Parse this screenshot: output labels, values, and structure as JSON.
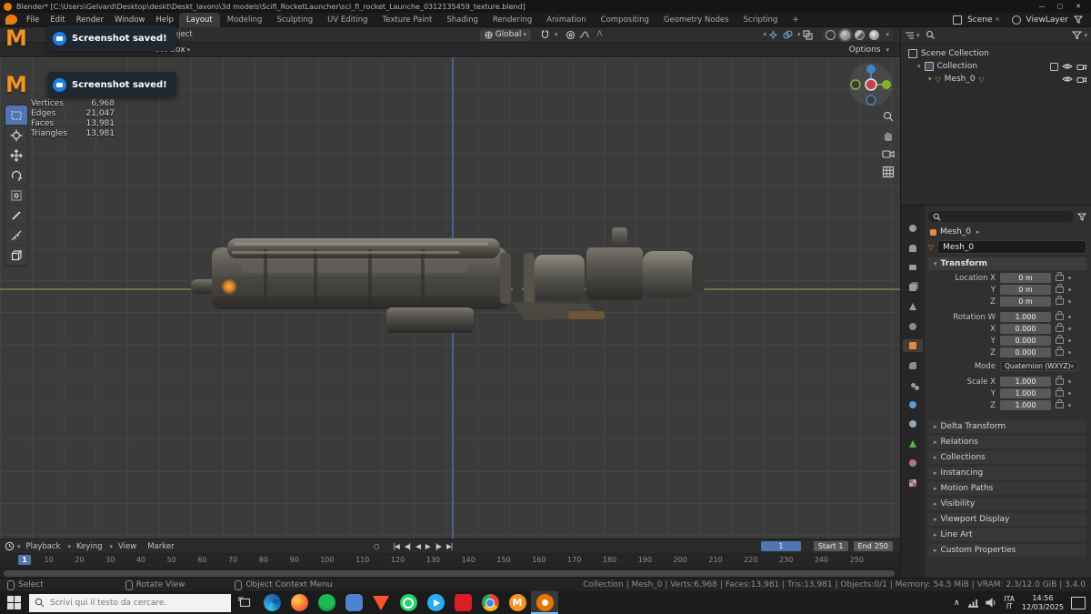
{
  "titlebar": {
    "title": "Blender* [C:\\Users\\Gelvard\\Desktop\\deskt\\Deskt_lavoro\\3d models\\Scifi_RocketLauncher\\sci_fi_rocket_Launche_0312135459_texture.blend]"
  },
  "icons": {
    "chevron": "▾",
    "minimize": "—",
    "maximize": "▢",
    "close": "✕",
    "plus": "+",
    "record": "○"
  },
  "topbar": {
    "menus": [
      "File",
      "Edit",
      "Render",
      "Window",
      "Help"
    ],
    "tabs": [
      "Layout",
      "Modeling",
      "Sculpting",
      "UV Editing",
      "Texture Paint",
      "Shading",
      "Rendering",
      "Animation",
      "Compositing",
      "Geometry Nodes",
      "Scripting"
    ],
    "scene_label": "Scene",
    "viewlayer_label": "ViewLayer"
  },
  "viewport_header": {
    "object_menu": "Object",
    "orientation": "Global",
    "tool_name": "ect Box",
    "options_label": "Options"
  },
  "toasts": [
    {
      "text": "Screenshot saved!"
    },
    {
      "text": "Screenshot saved!"
    }
  ],
  "stats": {
    "rows": [
      {
        "label": "Vertices",
        "value": "6,968"
      },
      {
        "label": "Edges",
        "value": "21,047"
      },
      {
        "label": "Faces",
        "value": "13,981"
      },
      {
        "label": "Triangles",
        "value": "13,981"
      }
    ]
  },
  "tools": [
    "select-box",
    "cursor",
    "move",
    "rotate",
    "transform",
    "annotate",
    "measure",
    "add-cube"
  ],
  "outliner": {
    "scene_collection": "Scene Collection",
    "collection": "Collection",
    "mesh": "Mesh_0"
  },
  "properties": {
    "breadcrumb": "Mesh_0",
    "name_field": "Mesh_0",
    "transform_title": "Transform",
    "rows": [
      {
        "label": "Location X",
        "value": "0 m"
      },
      {
        "label": "Y",
        "value": "0 m"
      },
      {
        "label": "Z",
        "value": "0 m"
      },
      {
        "label": "Rotation W",
        "value": "1.000"
      },
      {
        "label": "X",
        "value": "0.000"
      },
      {
        "label": "Y",
        "value": "0.000"
      },
      {
        "label": "Z",
        "value": "0.000"
      },
      {
        "label": "Mode",
        "value": "Quaternion (WXYZ)"
      },
      {
        "label": "Scale X",
        "value": "1.000"
      },
      {
        "label": "Y",
        "value": "1.000"
      },
      {
        "label": "Z",
        "value": "1.000"
      }
    ],
    "sections": [
      "Delta Transform",
      "Relations",
      "Collections",
      "Instancing",
      "Motion Paths",
      "Visibility",
      "Viewport Display",
      "Line Art",
      "Custom Properties"
    ]
  },
  "timeline": {
    "menus": [
      "Playback",
      "Keying",
      "View",
      "Marker"
    ],
    "transport": [
      "|◀",
      "◀|",
      "◀",
      "▶",
      "|▶",
      "▶|"
    ],
    "current_frame": "1",
    "start_label": "Start",
    "start_value": "1",
    "end_label": "End",
    "end_value": "250",
    "frames": [
      "1",
      "10",
      "20",
      "30",
      "40",
      "50",
      "60",
      "70",
      "80",
      "90",
      "100",
      "110",
      "120",
      "130",
      "140",
      "150",
      "160",
      "170",
      "180",
      "190",
      "200",
      "210",
      "220",
      "230",
      "240",
      "250"
    ]
  },
  "statusbar": {
    "select": "Select",
    "rotate": "Rotate View",
    "context": "Object Context Menu",
    "info": "Collection | Mesh_0 | Verts:6,968 | Faces:13,981 | Tris:13,981 | Objects:0/1 | Memory: 54.5 MiB | VRAM: 2.3/12.0 GiB | 3.4.0"
  },
  "taskbar": {
    "search_placeholder": "Scrivi qui il testo da cercare.",
    "apps": [
      "edge",
      "firefox",
      "spotify",
      "discord",
      "brave",
      "whatsapp",
      "telegram",
      "netflix",
      "chrome",
      "medal",
      "blender"
    ],
    "lang_top": "ITA",
    "lang_bottom": "IT",
    "time": "14:56",
    "date": "12/03/2025"
  }
}
